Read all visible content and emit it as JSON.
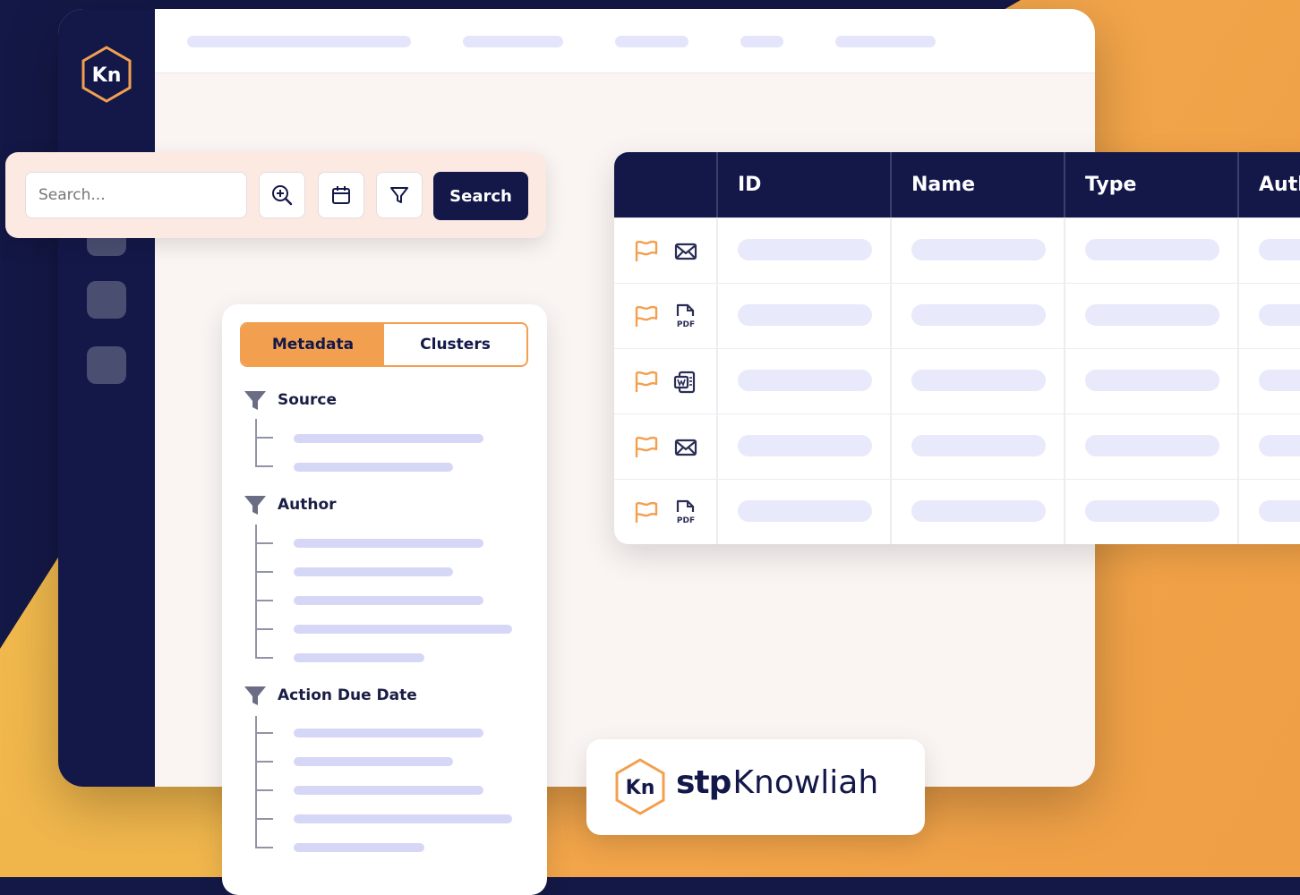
{
  "app": {
    "logo_monogram": "Kn",
    "brand_prefix": "stp",
    "brand_name": "Knowliah"
  },
  "search": {
    "placeholder": "Search...",
    "button_label": "Search",
    "tools": [
      "zoom-in-icon",
      "calendar-icon",
      "filter-icon"
    ]
  },
  "filters": {
    "tabs": [
      {
        "label": "Metadata",
        "active": true
      },
      {
        "label": "Clusters",
        "active": false
      }
    ],
    "groups": [
      {
        "label": "Source"
      },
      {
        "label": "Author"
      },
      {
        "label": "Action Due Date"
      }
    ]
  },
  "table": {
    "columns": [
      "ID",
      "Name",
      "Type",
      "Auth"
    ],
    "rows": [
      {
        "flag": "flag-icon",
        "doc_type": "email-icon"
      },
      {
        "flag": "flag-icon",
        "doc_type": "pdf-icon"
      },
      {
        "flag": "flag-icon",
        "doc_type": "word-icon"
      },
      {
        "flag": "flag-icon",
        "doc_type": "email-icon"
      },
      {
        "flag": "flag-icon",
        "doc_type": "pdf-icon"
      }
    ]
  },
  "colors": {
    "navy": "#131849",
    "accent_orange": "#f2a050",
    "placeholder_pill": "#e4e5fb"
  }
}
